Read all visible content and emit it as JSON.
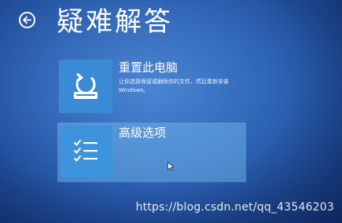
{
  "header": {
    "title": "疑难解答",
    "back_icon": "back-arrow-icon"
  },
  "options": [
    {
      "title": "重置此电脑",
      "description": "让你选择保留或删除你的文件，然后重新安装 Windows。",
      "icon": "reset-pc-icon"
    },
    {
      "title": "高级选项",
      "description": "",
      "icon": "checklist-icon"
    }
  ],
  "watermark": "https://blog.csdn.net/qq_43546203",
  "colors": {
    "background": "#2d63b4",
    "tile": "#3a8ad6",
    "highlight": "#78bef0"
  }
}
